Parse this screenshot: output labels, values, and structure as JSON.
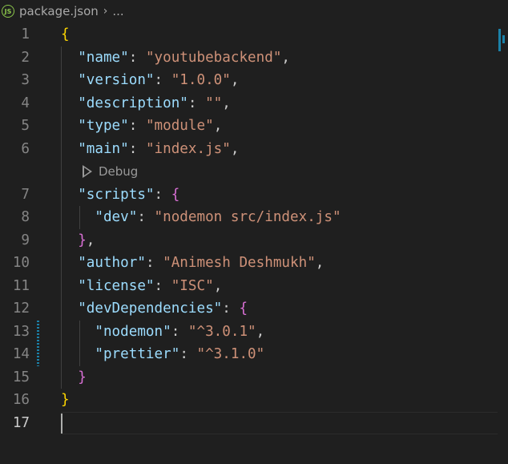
{
  "breadcrumb": {
    "icon": "json-file-icon",
    "icon_glyph": "JS",
    "file": "package.json",
    "separator": "›",
    "more": "..."
  },
  "codelens": {
    "label": "Debug",
    "after_line": 6
  },
  "active_line": 17,
  "lines": [
    {
      "n": "1",
      "tokens": [
        {
          "t": "{",
          "c": "b1"
        }
      ]
    },
    {
      "n": "2",
      "tokens": [
        {
          "t": "  ",
          "c": "p"
        },
        {
          "t": "\"name\"",
          "c": "k"
        },
        {
          "t": ": ",
          "c": "p"
        },
        {
          "t": "\"youtubebackend\"",
          "c": "s"
        },
        {
          "t": ",",
          "c": "p"
        }
      ]
    },
    {
      "n": "3",
      "tokens": [
        {
          "t": "  ",
          "c": "p"
        },
        {
          "t": "\"version\"",
          "c": "k"
        },
        {
          "t": ": ",
          "c": "p"
        },
        {
          "t": "\"1.0.0\"",
          "c": "s"
        },
        {
          "t": ",",
          "c": "p"
        }
      ]
    },
    {
      "n": "4",
      "tokens": [
        {
          "t": "  ",
          "c": "p"
        },
        {
          "t": "\"description\"",
          "c": "k"
        },
        {
          "t": ": ",
          "c": "p"
        },
        {
          "t": "\"\"",
          "c": "s"
        },
        {
          "t": ",",
          "c": "p"
        }
      ]
    },
    {
      "n": "5",
      "tokens": [
        {
          "t": "  ",
          "c": "p"
        },
        {
          "t": "\"type\"",
          "c": "k"
        },
        {
          "t": ": ",
          "c": "p"
        },
        {
          "t": "\"module\"",
          "c": "s"
        },
        {
          "t": ",",
          "c": "p"
        }
      ]
    },
    {
      "n": "6",
      "tokens": [
        {
          "t": "  ",
          "c": "p"
        },
        {
          "t": "\"main\"",
          "c": "k"
        },
        {
          "t": ": ",
          "c": "p"
        },
        {
          "t": "\"index.js\"",
          "c": "s"
        },
        {
          "t": ",",
          "c": "p"
        }
      ]
    },
    {
      "n": "7",
      "tokens": [
        {
          "t": "  ",
          "c": "p"
        },
        {
          "t": "\"scripts\"",
          "c": "k"
        },
        {
          "t": ": ",
          "c": "p"
        },
        {
          "t": "{",
          "c": "b2"
        }
      ]
    },
    {
      "n": "8",
      "tokens": [
        {
          "t": "    ",
          "c": "p"
        },
        {
          "t": "\"dev\"",
          "c": "k"
        },
        {
          "t": ": ",
          "c": "p"
        },
        {
          "t": "\"nodemon src/index.js\"",
          "c": "s"
        }
      ]
    },
    {
      "n": "9",
      "tokens": [
        {
          "t": "  ",
          "c": "p"
        },
        {
          "t": "}",
          "c": "b2"
        },
        {
          "t": ",",
          "c": "p"
        }
      ]
    },
    {
      "n": "10",
      "tokens": [
        {
          "t": "  ",
          "c": "p"
        },
        {
          "t": "\"author\"",
          "c": "k"
        },
        {
          "t": ": ",
          "c": "p"
        },
        {
          "t": "\"Animesh Deshmukh\"",
          "c": "s"
        },
        {
          "t": ",",
          "c": "p"
        }
      ]
    },
    {
      "n": "11",
      "tokens": [
        {
          "t": "  ",
          "c": "p"
        },
        {
          "t": "\"license\"",
          "c": "k"
        },
        {
          "t": ": ",
          "c": "p"
        },
        {
          "t": "\"ISC\"",
          "c": "s"
        },
        {
          "t": ",",
          "c": "p"
        }
      ]
    },
    {
      "n": "12",
      "tokens": [
        {
          "t": "  ",
          "c": "p"
        },
        {
          "t": "\"devDependencies\"",
          "c": "k"
        },
        {
          "t": ": ",
          "c": "p"
        },
        {
          "t": "{",
          "c": "b2"
        }
      ]
    },
    {
      "n": "13",
      "tokens": [
        {
          "t": "    ",
          "c": "p"
        },
        {
          "t": "\"nodemon\"",
          "c": "k"
        },
        {
          "t": ": ",
          "c": "p"
        },
        {
          "t": "\"^3.0.1\"",
          "c": "s"
        },
        {
          "t": ",",
          "c": "p"
        }
      ]
    },
    {
      "n": "14",
      "tokens": [
        {
          "t": "    ",
          "c": "p"
        },
        {
          "t": "\"prettier\"",
          "c": "k"
        },
        {
          "t": ": ",
          "c": "p"
        },
        {
          "t": "\"^3.1.0\"",
          "c": "s"
        }
      ]
    },
    {
      "n": "15",
      "tokens": [
        {
          "t": "  ",
          "c": "p"
        },
        {
          "t": "}",
          "c": "b2"
        }
      ]
    },
    {
      "n": "16",
      "tokens": [
        {
          "t": "}",
          "c": "b1"
        }
      ]
    },
    {
      "n": "17",
      "tokens": []
    }
  ],
  "colors": {
    "background": "#1f1f1f",
    "key": "#9cdcfe",
    "string": "#ce9178",
    "bracket_level1": "#ffd700",
    "bracket_level2": "#da70d6",
    "line_number": "#858585",
    "modified_gutter": "#1b81a8"
  }
}
